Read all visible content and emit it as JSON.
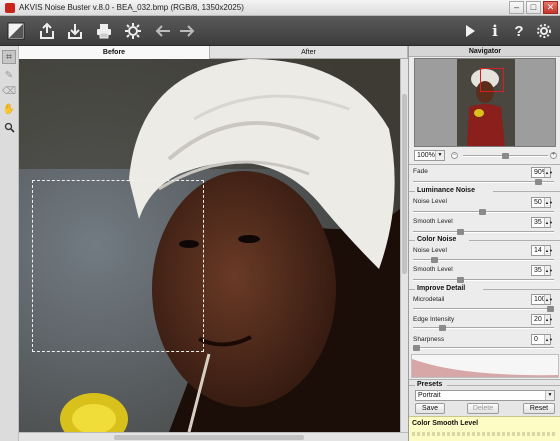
{
  "window": {
    "title": "AKVIS Noise Buster v.8.0 - BEA_032.bmp (RGB/8, 1350x2025)",
    "controls": [
      "minimize",
      "maximize",
      "close"
    ]
  },
  "toolbar": {
    "left_icons": [
      "before-after-icon",
      "open-icon",
      "save-icon",
      "print-icon",
      "batch-icon",
      "undo-icon",
      "redo-icon"
    ],
    "right_icons": [
      "run-icon",
      "info-icon",
      "help-icon",
      "settings-icon"
    ]
  },
  "tools": [
    "fragment-tool-icon",
    "correction-brush-icon",
    "eraser-icon",
    "hand-icon",
    "zoom-icon"
  ],
  "tabs": {
    "before": "Before",
    "after": "After",
    "active": "Before"
  },
  "navigator": {
    "title": "Navigator",
    "zoom": "100%"
  },
  "fade": {
    "label": "Fade",
    "value": "90%",
    "level_percent": 90
  },
  "sections": {
    "luminance": {
      "title": "Luminance Noise",
      "params": [
        {
          "label": "Noise Level",
          "value": "50",
          "level": 50
        },
        {
          "label": "Smooth Level",
          "value": "35",
          "level": 35
        }
      ]
    },
    "color": {
      "title": "Color Noise",
      "params": [
        {
          "label": "Noise Level",
          "value": "14",
          "level": 14
        },
        {
          "label": "Smooth Level",
          "value": "35",
          "level": 35
        }
      ]
    },
    "detail": {
      "title": "Improve Detail",
      "params": [
        {
          "label": "Microdetail",
          "value": "100",
          "level": 100
        },
        {
          "label": "Edge Intensity",
          "value": "20",
          "level": 20
        },
        {
          "label": "Sharpness",
          "value": "0",
          "level": 0
        }
      ]
    }
  },
  "presets": {
    "title": "Presets",
    "selected": "Portrait",
    "save": "Save",
    "delete": "Delete",
    "reset": "Reset"
  },
  "help": {
    "title": "Color Smooth Level"
  }
}
